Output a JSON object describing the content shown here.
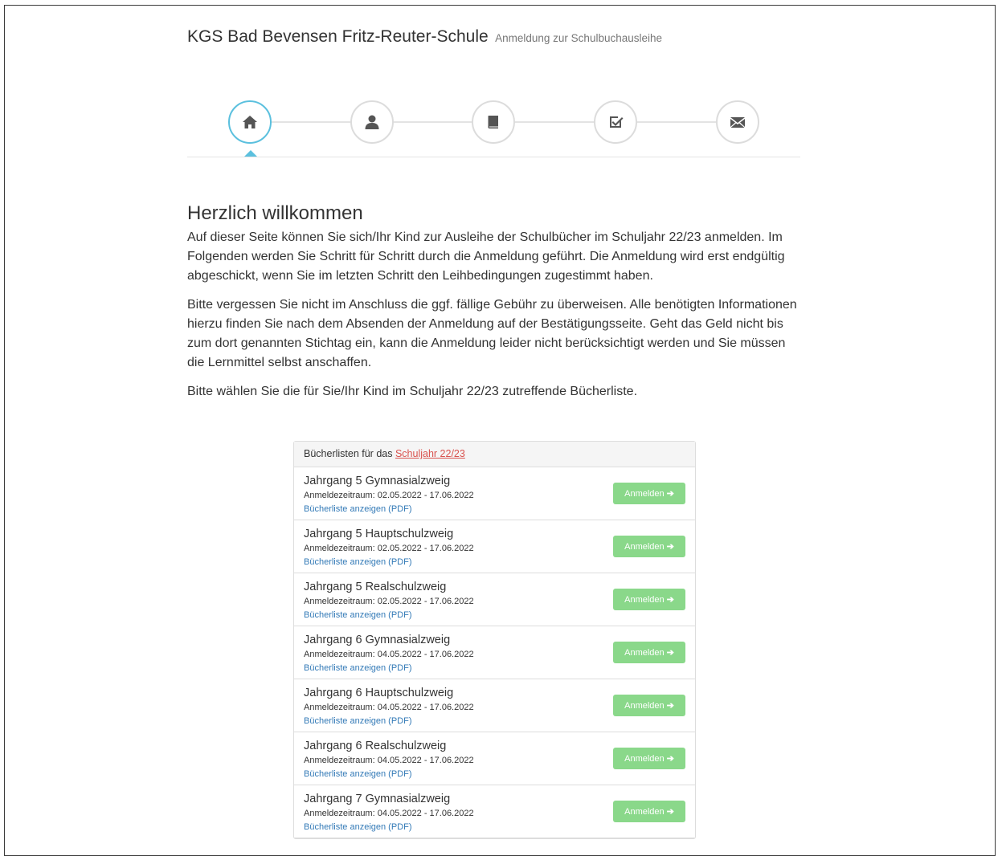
{
  "header": {
    "title": "KGS Bad Bevensen Fritz-Reuter-Schule",
    "subtitle": "Anmeldung zur Schulbuchausleihe"
  },
  "steps": [
    {
      "icon": "home-icon",
      "active": true
    },
    {
      "icon": "user-icon",
      "active": false
    },
    {
      "icon": "book-icon",
      "active": false
    },
    {
      "icon": "check-icon",
      "active": false
    },
    {
      "icon": "envelope-icon",
      "active": false
    }
  ],
  "welcome": {
    "heading": "Herzlich willkommen",
    "p1": "Auf dieser Seite können Sie sich/Ihr Kind zur Ausleihe der Schulbücher im Schuljahr 22/23 anmelden. Im Folgenden werden Sie Schritt für Schritt durch die Anmeldung geführt. Die Anmeldung wird erst endgültig abgeschickt, wenn Sie im letzten Schritt den Leihbedingungen zugestimmt haben.",
    "p2": "Bitte vergessen Sie nicht im Anschluss die ggf. fällige Gebühr zu überweisen. Alle benötigten Informationen hierzu finden Sie nach dem Absenden der Anmeldung auf der Bestätigungsseite. Geht das Geld nicht bis zum dort genannten Stichtag ein, kann die Anmeldung leider nicht berücksichtigt werden und Sie müssen die Lernmittel selbst anschaffen.",
    "p3": "Bitte wählen Sie die für Sie/Ihr Kind im Schuljahr 22/23 zutreffende Bücherliste."
  },
  "panel": {
    "heading_prefix": "Bücherlisten für das",
    "heading_link": "Schuljahr 22/23",
    "button_label": "Anmelden",
    "button_arrow": "➔",
    "items": [
      {
        "name": "Jahrgang 5 Gymnasialzweig",
        "period": "Anmeldezeitraum: 02.05.2022 - 17.06.2022",
        "pdf": "Bücherliste anzeigen (PDF)"
      },
      {
        "name": "Jahrgang 5 Hauptschulzweig",
        "period": "Anmeldezeitraum: 02.05.2022 - 17.06.2022",
        "pdf": "Bücherliste anzeigen (PDF)"
      },
      {
        "name": "Jahrgang 5 Realschulzweig",
        "period": "Anmeldezeitraum: 02.05.2022 - 17.06.2022",
        "pdf": "Bücherliste anzeigen (PDF)"
      },
      {
        "name": "Jahrgang 6 Gymnasialzweig",
        "period": "Anmeldezeitraum: 04.05.2022 - 17.06.2022",
        "pdf": "Bücherliste anzeigen (PDF)"
      },
      {
        "name": "Jahrgang 6 Hauptschulzweig",
        "period": "Anmeldezeitraum: 04.05.2022 - 17.06.2022",
        "pdf": "Bücherliste anzeigen (PDF)"
      },
      {
        "name": "Jahrgang 6 Realschulzweig",
        "period": "Anmeldezeitraum: 04.05.2022 - 17.06.2022",
        "pdf": "Bücherliste anzeigen (PDF)"
      },
      {
        "name": "Jahrgang 7 Gymnasialzweig",
        "period": "Anmeldezeitraum: 04.05.2022 - 17.06.2022",
        "pdf": "Bücherliste anzeigen (PDF)"
      }
    ]
  },
  "colors": {
    "accent": "#5bc0de",
    "button": "#8ad88a",
    "link": "#337ab7",
    "heading_link": "#d9534f"
  }
}
